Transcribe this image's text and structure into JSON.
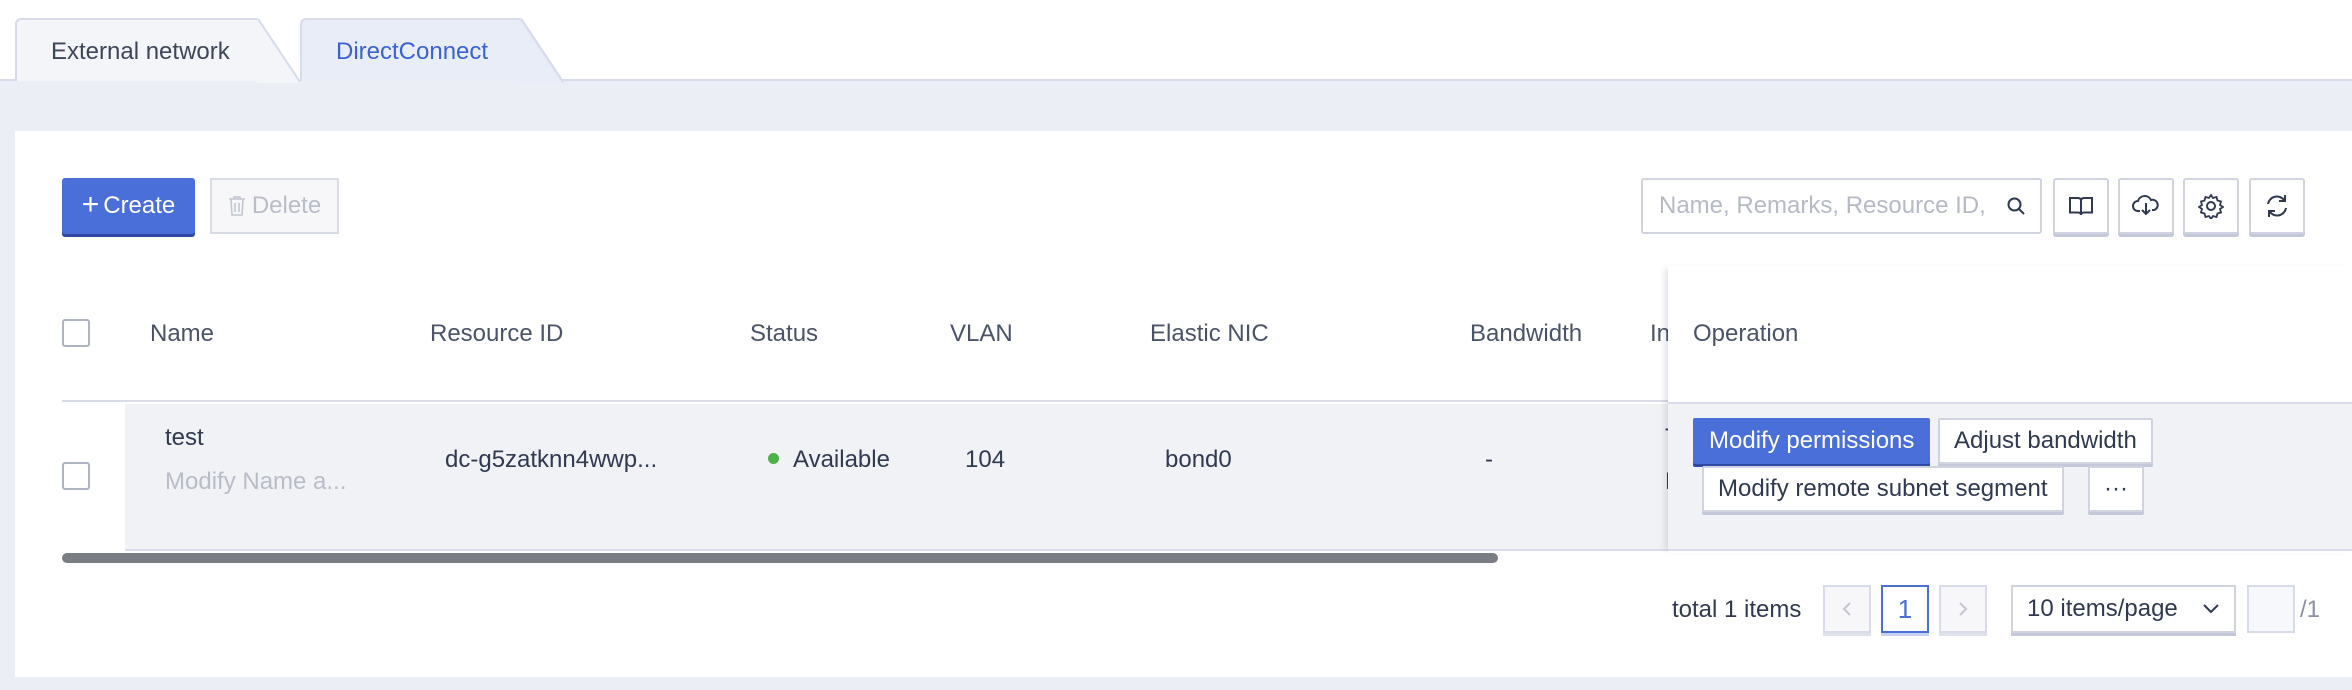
{
  "tabs": [
    {
      "label": "External network",
      "active": false
    },
    {
      "label": "DirectConnect",
      "active": true
    }
  ],
  "toolbar": {
    "create_label": "Create",
    "delete_label": "Delete",
    "search_placeholder": "Name, Remarks, Resource ID,"
  },
  "table": {
    "columns": [
      "Name",
      "Resource ID",
      "Status",
      "VLAN",
      "Elastic NIC",
      "Bandwidth",
      "In",
      "Operation"
    ],
    "rows": [
      {
        "name": "test",
        "name_sub": "Modify Name a...",
        "resource_id": "dc-g5zatknn4wwp...",
        "status": "Available",
        "vlan": "104",
        "elastic_nic": "bond0",
        "bandwidth": "-",
        "in_line1": "Th",
        "in_line2": "Re",
        "operations": {
          "modify_permissions": "Modify permissions",
          "adjust_bandwidth": "Adjust bandwidth",
          "modify_remote_subnet": "Modify remote subnet segment",
          "more": "···"
        }
      }
    ]
  },
  "pagination": {
    "total_text": "total 1 items",
    "current_page": "1",
    "page_size": "10 items/page",
    "total_pages": "/1"
  },
  "colors": {
    "primary": "#4a6fd8",
    "status_available": "#4cb14a",
    "active_tab_text": "#3a62d0"
  }
}
